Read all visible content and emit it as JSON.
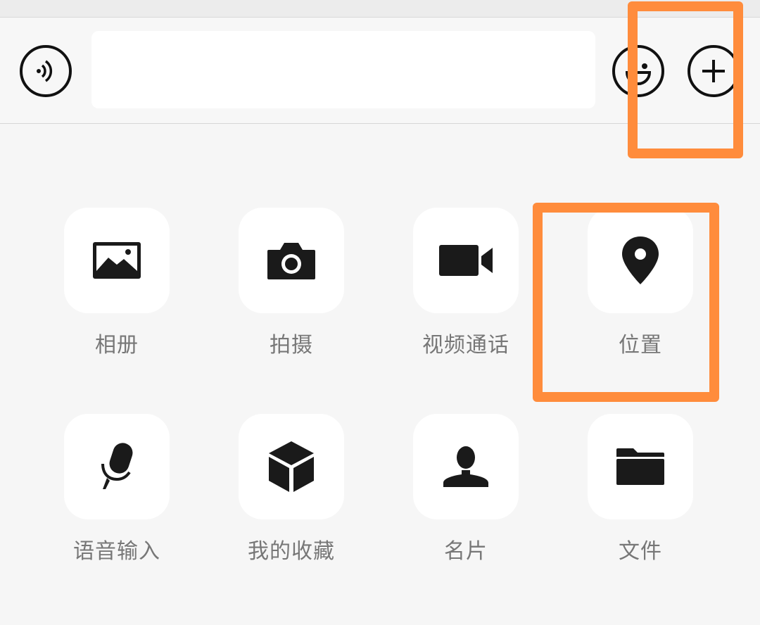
{
  "input_bar": {
    "voice_icon": "voice-icon",
    "emoji_icon": "emoji-icon",
    "plus_icon": "plus-icon",
    "text_value": ""
  },
  "panel": {
    "items": [
      {
        "label": "相册",
        "icon": "photo-album-icon"
      },
      {
        "label": "拍摄",
        "icon": "camera-icon"
      },
      {
        "label": "视频通话",
        "icon": "video-call-icon"
      },
      {
        "label": "位置",
        "icon": "location-pin-icon"
      },
      {
        "label": "语音输入",
        "icon": "microphone-icon"
      },
      {
        "label": "我的收藏",
        "icon": "favorites-cube-icon"
      },
      {
        "label": "名片",
        "icon": "contact-card-icon"
      },
      {
        "label": "文件",
        "icon": "folder-icon"
      }
    ]
  },
  "colors": {
    "background": "#f6f6f6",
    "tile": "#ffffff",
    "icon": "#1a1a1a",
    "label": "#777777",
    "highlight": "#ff8c3c"
  }
}
